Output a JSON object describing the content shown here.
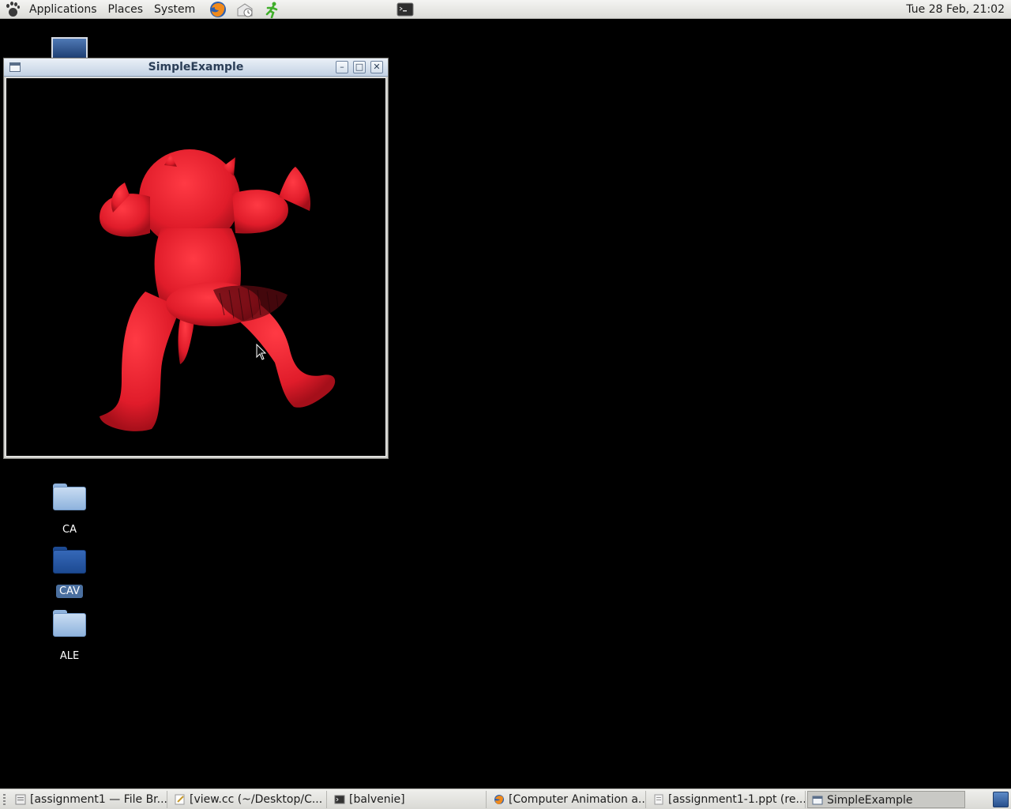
{
  "top_panel": {
    "menus": [
      "Applications",
      "Places",
      "System"
    ],
    "launchers": [
      "firefox-icon",
      "mail-clock-icon",
      "running-man-icon",
      "terminal-icon"
    ],
    "clock": "Tue 28 Feb, 21:02"
  },
  "window": {
    "title": "SimpleExample",
    "content": "red 3D armadillo model rendered on black background",
    "model_color": "#e8202e"
  },
  "desktop": {
    "icons": [
      {
        "label": "CA",
        "style": "light"
      },
      {
        "label": "CAV",
        "style": "dark",
        "selected": true
      },
      {
        "label": "ALE",
        "style": "light"
      }
    ]
  },
  "taskbar": {
    "tasks": [
      {
        "label": "[assignment1 — File Br...",
        "icon": "file-browser-icon"
      },
      {
        "label": "[view.cc (~/Desktop/C...",
        "icon": "text-editor-icon"
      },
      {
        "label": "[balvenie]",
        "icon": "terminal-icon"
      },
      {
        "label": "[Computer Animation a...",
        "icon": "firefox-icon"
      },
      {
        "label": "[assignment1-1.ppt (re...",
        "icon": "document-icon"
      },
      {
        "label": "SimpleExample",
        "icon": "window-icon",
        "active": true
      }
    ]
  }
}
